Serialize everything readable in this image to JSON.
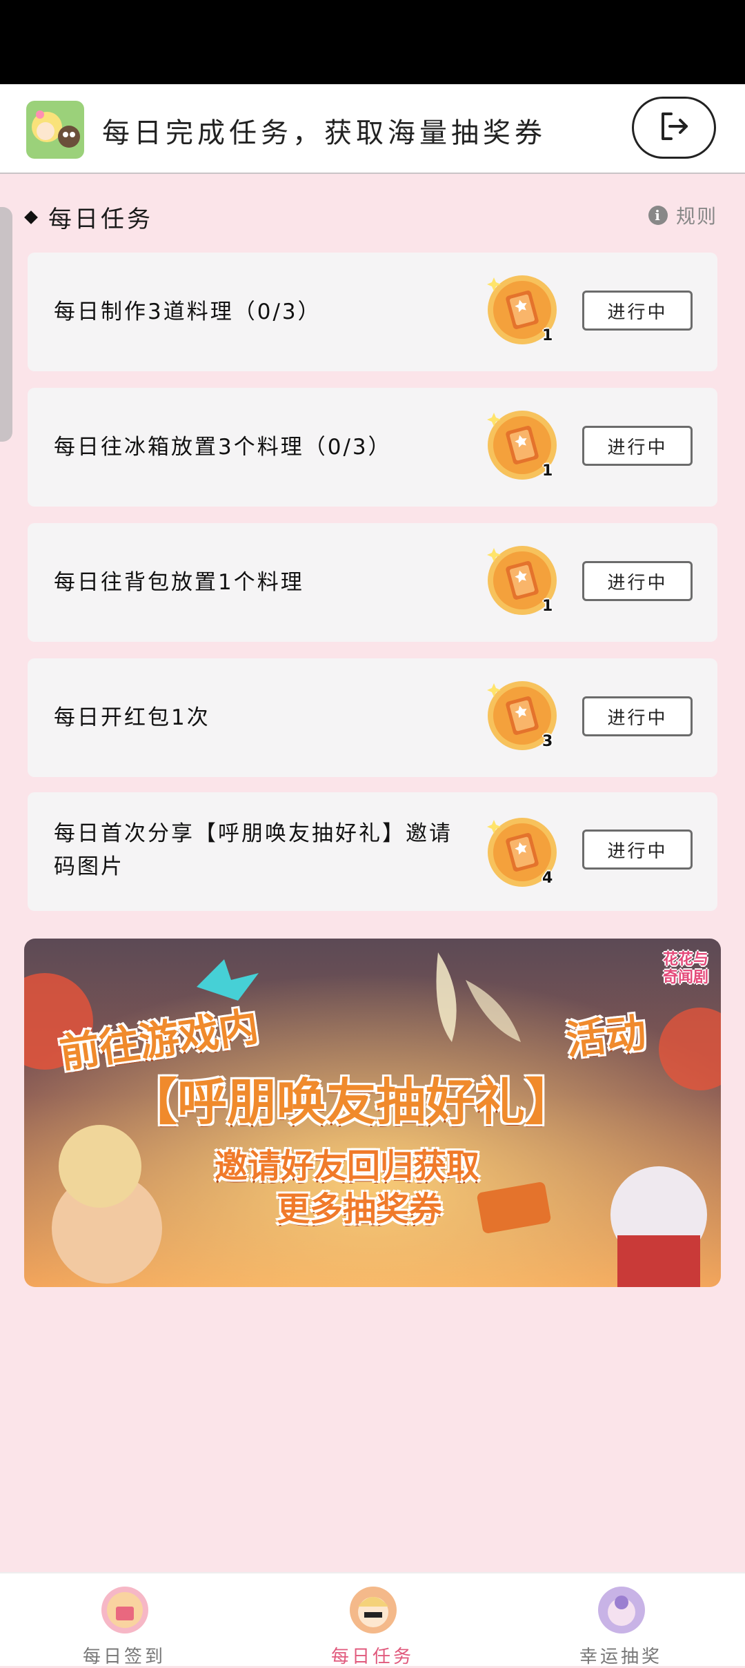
{
  "header": {
    "title": "每日完成任务，获取海量抽奖券"
  },
  "section": {
    "title": "每日任务",
    "rules_label": "规则"
  },
  "tasks": [
    {
      "label": "每日制作3道料理（0/3）",
      "reward": "1",
      "status": "进行中"
    },
    {
      "label": "每日往冰箱放置3个料理（0/3）",
      "reward": "1",
      "status": "进行中"
    },
    {
      "label": "每日往背包放置1个料理",
      "reward": "1",
      "status": "进行中"
    },
    {
      "label": "每日开红包1次",
      "reward": "3",
      "status": "进行中"
    },
    {
      "label": "每日首次分享【呼朋唤友抽好礼】邀请码图片",
      "reward": "4",
      "status": "进行中"
    }
  ],
  "banner": {
    "logo": "花花与\n奇闻剧",
    "line1_a": "前往游戏内",
    "line1_b": "活动",
    "line2": "【呼朋唤友抽好礼】",
    "line3": "邀请好友回归获取",
    "line4": "更多抽奖券"
  },
  "tabbar": {
    "items": [
      {
        "label": "每日签到"
      },
      {
        "label": "每日任务"
      },
      {
        "label": "幸运抽奖"
      }
    ]
  },
  "colors": {
    "background": "#fbe4e9",
    "active_tab": "#e05a7d",
    "coin": "#f4a13c"
  },
  "icons": {
    "exit": "exit-icon",
    "info": "info-icon",
    "coin": "ticket-coin-icon"
  }
}
